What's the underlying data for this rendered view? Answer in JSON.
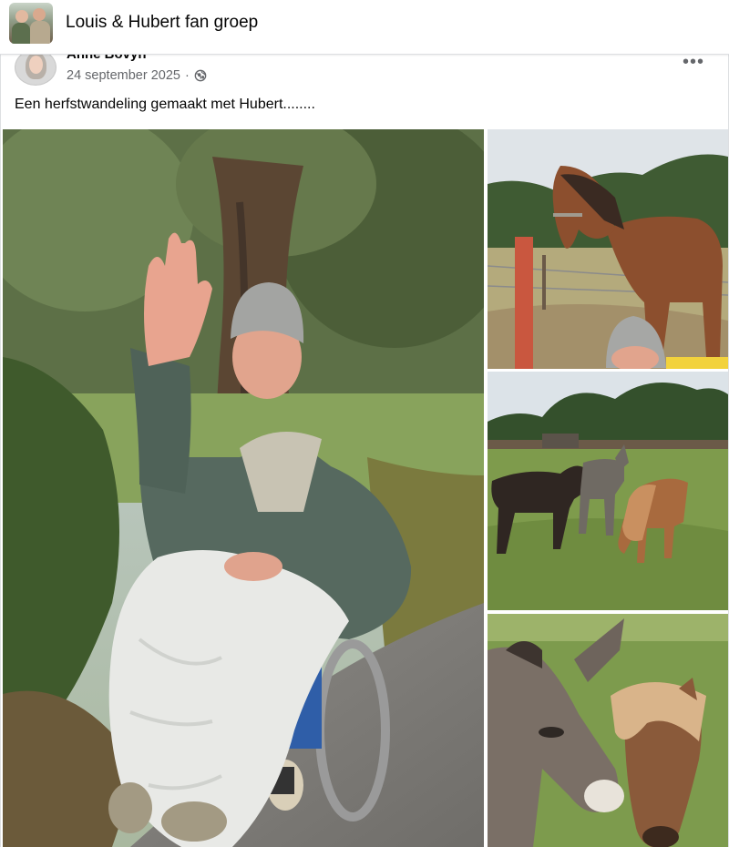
{
  "group": {
    "name": "Louis & Hubert fan groep",
    "avatar_icon": "group-photo"
  },
  "post": {
    "author": "Anne Bovyn",
    "date": "24 september 2025",
    "separator": "·",
    "privacy_icon": "globe-icon",
    "more_label": "•••",
    "text": "Een herfstwandeling gemaakt met Hubert........"
  },
  "photos": [
    {
      "subject": "man-in-wheelchair-waving"
    },
    {
      "subject": "brown-horse-at-fence"
    },
    {
      "subject": "donkeys-in-field"
    },
    {
      "subject": "donkey-and-pony-closeup"
    }
  ],
  "colors": {
    "text_secondary": "#65676b",
    "border": "#dddfe2"
  }
}
